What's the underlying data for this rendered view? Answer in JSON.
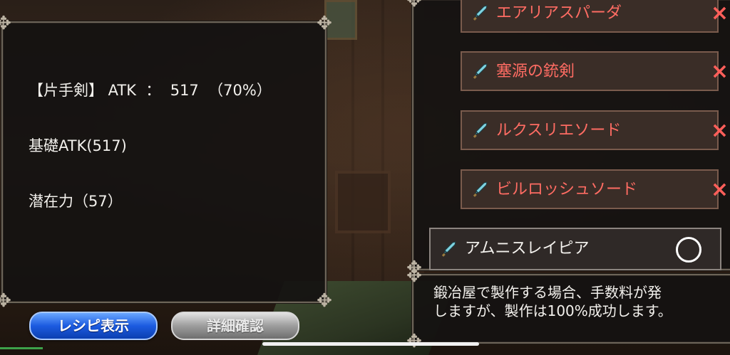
{
  "stats": {
    "line1": "【片手剣】 ATK  ：  517  （70%）",
    "line2": "基礎ATK(517)",
    "line3": "潜在力（57）"
  },
  "buttons": {
    "recipe": "レシピ表示",
    "detail": "詳細確認"
  },
  "items": [
    {
      "name": "エアリアスパーダ",
      "status": "×"
    },
    {
      "name": "塞源の銃剣",
      "status": "×"
    },
    {
      "name": "ルクスリエソード",
      "status": "×"
    },
    {
      "name": "ビルロッシュソード",
      "status": "×"
    }
  ],
  "available_item": {
    "name": "アムニスレイピア",
    "status": "○"
  },
  "description": {
    "line1": "鍛冶屋で製作する場合、手数料が発",
    "line2": "しますが、製作は100%成功します。"
  },
  "colors": {
    "unavailable": "#ff6c63",
    "recipe_button": "#1c5be0",
    "detail_button": "#9d9d9d",
    "sword_icon": "#7fd3e0"
  },
  "icons": {
    "item": "sword-icon",
    "unavailable": "cross-icon",
    "available": "circle-icon"
  }
}
